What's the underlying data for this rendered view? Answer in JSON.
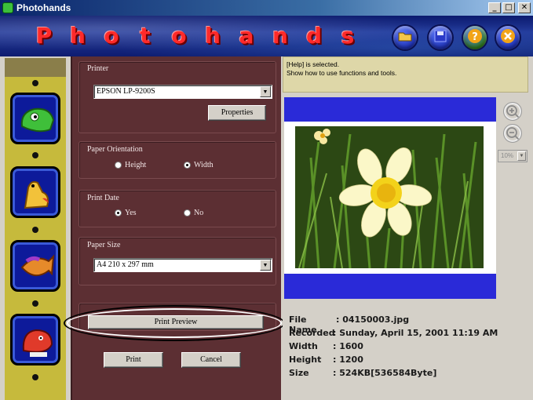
{
  "window": {
    "title": "Photohands"
  },
  "banner": {
    "logo_letters": [
      "P",
      "h",
      "o",
      "t",
      "o",
      "h",
      "a",
      "n",
      "d",
      "s"
    ],
    "buttons": [
      {
        "name": "open-folder",
        "glyph": "▰",
        "color": "#1c2fb0"
      },
      {
        "name": "save",
        "glyph": "▣",
        "color": "#1c2fb0"
      },
      {
        "name": "help",
        "glyph": "?",
        "color": "#2e7a1a"
      },
      {
        "name": "exit",
        "glyph": "✕",
        "color": "#1c2fb0"
      }
    ]
  },
  "sidebar": {
    "tiles": [
      {
        "name": "chameleon",
        "color": "#3fbf3a"
      },
      {
        "name": "giraffe",
        "color": "#f2c23a"
      },
      {
        "name": "fish",
        "color": "#e68a2a"
      },
      {
        "name": "dragon",
        "color": "#e03a2a"
      }
    ]
  },
  "panel": {
    "printer_label": "Printer",
    "printer_value": "EPSON LP-9200S",
    "properties_label": "Properties",
    "orientation_label": "Paper Orientation",
    "orientation_options": [
      "Height",
      "Width"
    ],
    "orientation_selected": "Width",
    "print_date_label": "Print Date",
    "print_date_options": [
      "Yes",
      "No"
    ],
    "print_date_selected": "Yes",
    "paper_size_label": "Paper Size",
    "paper_size_value": "A4 210 x 297 mm",
    "print_preview_label": "Print Preview",
    "print_label": "Print",
    "cancel_label": "Cancel"
  },
  "status": {
    "line1": "[Help] is selected.",
    "line2": "Show how to use functions and tools."
  },
  "zoom": {
    "level": "10%"
  },
  "file_info": [
    {
      "key": "File Name",
      "value": ": 04150003.jpg"
    },
    {
      "key": "Recorded",
      "value": ": Sunday, April 15, 2001 11:19 AM"
    },
    {
      "key": "Width",
      "value": ": 1600"
    },
    {
      "key": "Height",
      "value": ": 1200"
    },
    {
      "key": "Size",
      "value": ": 524KB[536584Byte]"
    }
  ]
}
